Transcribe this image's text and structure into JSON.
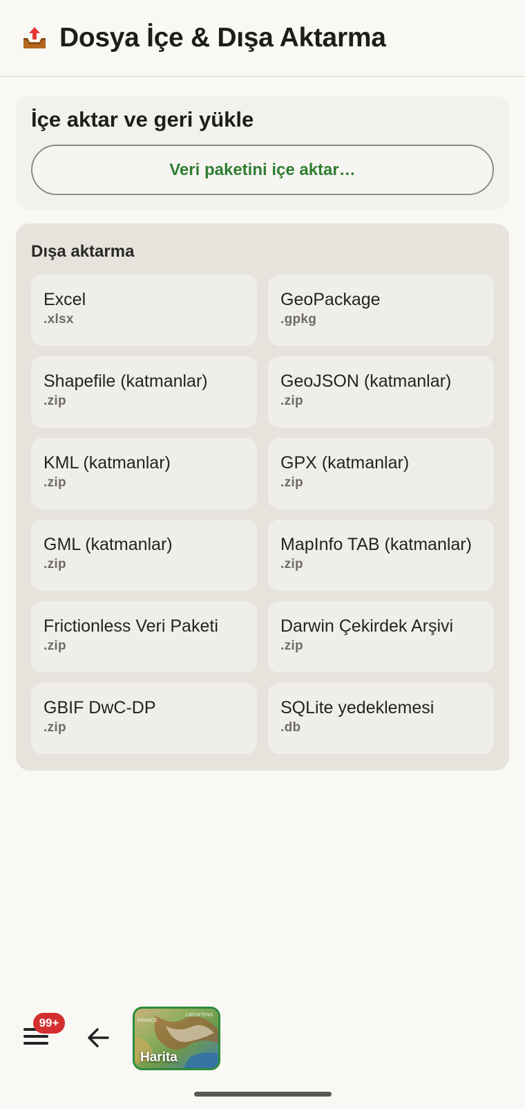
{
  "header": {
    "icon": "outbox-tray-icon",
    "title": "Dosya İçe & Dışa Aktarma"
  },
  "import_section": {
    "title": "İçe aktar ve geri yükle",
    "button_label": "Veri paketini içe aktar…"
  },
  "export_section": {
    "title": "Dışa aktarma",
    "items": [
      {
        "name": "Excel",
        "ext": ".xlsx"
      },
      {
        "name": "GeoPackage",
        "ext": ".gpkg"
      },
      {
        "name": "Shapefile (katmanlar)",
        "ext": ".zip"
      },
      {
        "name": "GeoJSON (katmanlar)",
        "ext": ".zip"
      },
      {
        "name": "KML (katmanlar)",
        "ext": ".zip"
      },
      {
        "name": "GPX (katmanlar)",
        "ext": ".zip"
      },
      {
        "name": "GML (katmanlar)",
        "ext": ".zip"
      },
      {
        "name": "MapInfo TAB (katmanlar)",
        "ext": ".zip"
      },
      {
        "name": "Frictionless Veri Paketi",
        "ext": ".zip"
      },
      {
        "name": "Darwin Çekirdek Arşivi",
        "ext": ".zip"
      },
      {
        "name": "GBIF DwC-DP",
        "ext": ".zip"
      },
      {
        "name": "SQLite yedeklemesi",
        "ext": ".db"
      }
    ]
  },
  "bottom_bar": {
    "menu_icon": "hamburger-menu-icon",
    "badge": "99+",
    "back_icon": "arrow-left-icon",
    "map_label": "Harita",
    "map_text_1": "FRANCE",
    "map_text_2": "LIECHTENS"
  },
  "colors": {
    "accent_green": "#2e7d32",
    "badge_red": "#d32f2f"
  }
}
